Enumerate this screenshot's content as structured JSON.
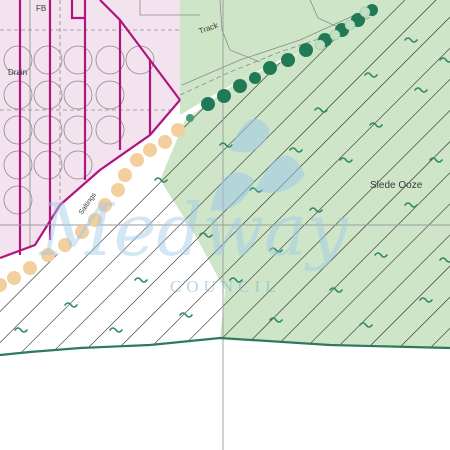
{
  "map": {
    "labels": {
      "fb": "FB",
      "track": "Track",
      "drain": "Drain",
      "saltings": "Saltings",
      "place_name": "Slede Ooze"
    },
    "watermark": {
      "brand": "Medway",
      "subtitle": "COUNCIL"
    },
    "colors": {
      "land_green": "#cfe5c8",
      "industrial_pink": "#f3e3ef",
      "boundary_magenta": "#b0157e",
      "tree_dark_green": "#1f7a55",
      "orange_dots": "#f2cf9c",
      "coastline": "#2e7a5c",
      "marsh_symbol": "#2e8b63",
      "watermark_blue": "#9ec9e8"
    }
  }
}
